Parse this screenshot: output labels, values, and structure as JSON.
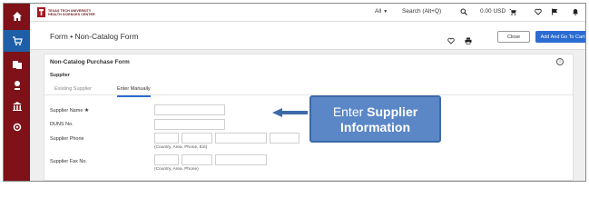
{
  "topbar": {
    "brand_line1": "TEXAS TECH UNIVERSITY",
    "brand_line2": "HEALTH SCIENCES CENTER",
    "scope": "All",
    "search_placeholder": "Search (Alt+Q)",
    "cart_total": "0.00 USD"
  },
  "subheader": {
    "breadcrumb": "Form  •  Non-Catalog Form",
    "close_label": "Close",
    "add_cart_label": "Add And Go To Cart"
  },
  "form": {
    "title": "Non-Catalog Purchase Form",
    "section": "Supplier",
    "tabs": [
      "Existing Supplier",
      "Enter Manually"
    ],
    "active_tab": 1,
    "fields": {
      "supplier_name_label": "Supplier Name",
      "required_mark": "★",
      "duns_label": "DUNS No.",
      "phone_label": "Supplier Phone",
      "phone_hint": "(Country, Area, Phone, Ext)",
      "fax_label": "Supplier Fax No.",
      "fax_hint": "(Country, Area, Phone)"
    }
  },
  "callout": {
    "prefix": "Enter ",
    "bold1": "Supplier",
    "bold2": "Information"
  },
  "colors": {
    "sidebar": "#7e1218",
    "accent": "#2b6cd2",
    "callout": "#5b87c7"
  }
}
